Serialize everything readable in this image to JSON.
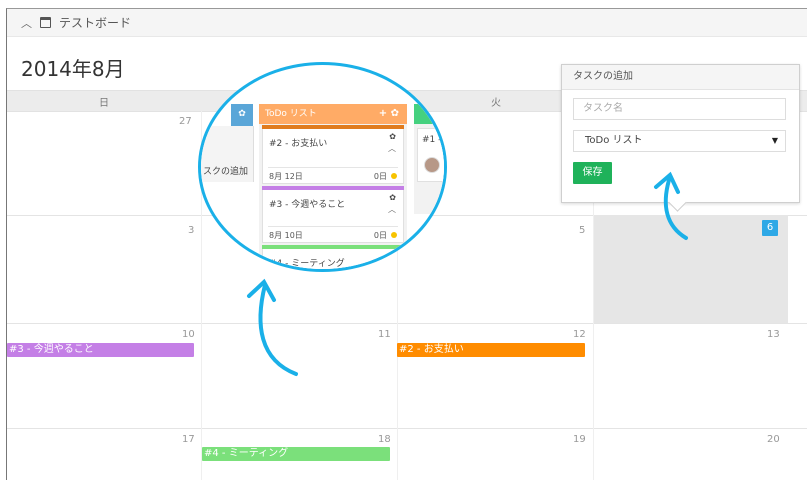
{
  "board": {
    "title": "テストボード",
    "collapse_icon": "chevron-up-icon",
    "board_icon": "board-icon"
  },
  "calendar": {
    "month_title": "2014年8月",
    "weekdays": [
      "日",
      "",
      "火",
      ""
    ],
    "day_numbers": {
      "r1": [
        "27",
        "",
        "",
        ""
      ],
      "r2": [
        "3",
        "",
        "5",
        "6"
      ],
      "r3": [
        "10",
        "11",
        "12",
        "13"
      ],
      "r4": [
        "17",
        "18",
        "19",
        "20"
      ]
    },
    "events": {
      "e1": "#3 - 今週やること",
      "e2": "#2 - お支払い",
      "e3": "#4 - ミーティング"
    }
  },
  "add_task_popover": {
    "title": "タスクの追加",
    "task_name_placeholder": "タスク名",
    "list_selected": "ToDo リスト",
    "save_label": "保存"
  },
  "zoom": {
    "column_title": "ToDo リスト",
    "left_card_text": "スクの追加",
    "cards": [
      {
        "title": "#2 - お支払い",
        "date": "8月 12日",
        "count": "0日"
      },
      {
        "title": "#3 - 今週やること",
        "date": "8月 10日",
        "count": "0日"
      },
      {
        "title": "#4 - ミーティング"
      }
    ],
    "side_card_text": "#1 -"
  },
  "colors": {
    "accent_blue": "#2ea8e6",
    "event_purple": "#c47fe6",
    "event_orange": "#ff8c00",
    "event_green": "#7be07b",
    "save_green": "#1fb25a",
    "todo_orange": "#ffab66"
  }
}
